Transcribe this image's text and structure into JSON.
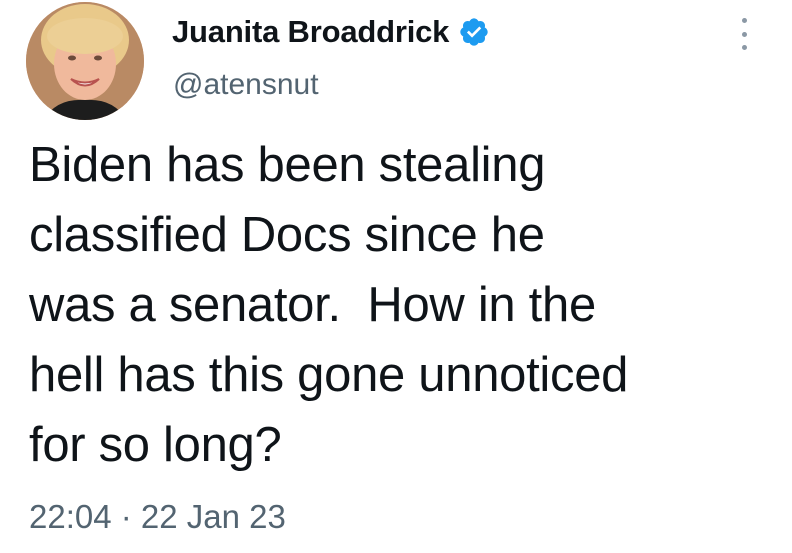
{
  "tweet": {
    "author": {
      "display_name": "Juanita Broaddrick",
      "handle": "@atensnut",
      "verified": true,
      "avatar_icon": "avatar-photo"
    },
    "text": "Biden has been stealing\nclassified Docs since he\nwas a senator.  How in the\nhell has this gone unnoticed\nfor so long?",
    "timestamp": "22:04 · 22 Jan 23",
    "more_icon": "more-options-icon"
  },
  "colors": {
    "text": "#0f1419",
    "secondary": "#536471",
    "verified_badge": "#1d9bf0"
  }
}
